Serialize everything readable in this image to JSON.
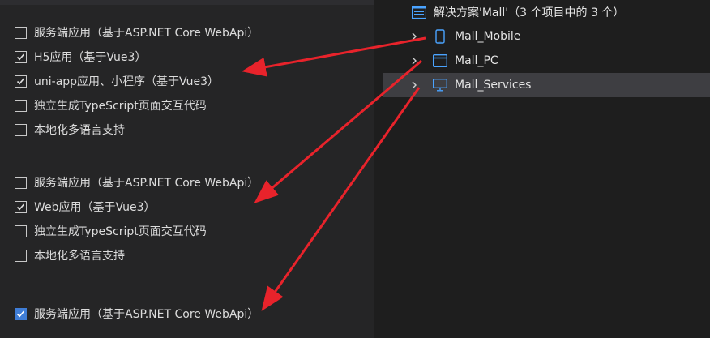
{
  "left": {
    "options": [
      {
        "label": "服务端应用（基于ASP.NET Core WebApi）",
        "checked": false
      },
      {
        "label": "H5应用（基于Vue3）",
        "checked": true
      },
      {
        "label": "uni-app应用、小程序（基于Vue3）",
        "checked": true
      },
      {
        "label": "独立生成TypeScript页面交互代码",
        "checked": false
      },
      {
        "label": "本地化多语言支持",
        "checked": false
      },
      {
        "label": "服务端应用（基于ASP.NET Core WebApi）",
        "checked": false
      },
      {
        "label": "Web应用（基于Vue3）",
        "checked": true
      },
      {
        "label": "独立生成TypeScript页面交互代码",
        "checked": false
      },
      {
        "label": "本地化多语言支持",
        "checked": false
      },
      {
        "label": "服务端应用（基于ASP.NET Core WebApi）",
        "checked": true
      }
    ]
  },
  "solution": {
    "title": "解决方案'Mall'（3 个项目中的 3 个）",
    "projects": [
      {
        "name": "Mall_Mobile",
        "icon": "mobile-icon"
      },
      {
        "name": "Mall_PC",
        "icon": "window-icon"
      },
      {
        "name": "Mall_Services",
        "icon": "monitor-icon"
      }
    ]
  },
  "colors": {
    "arrow": "#e8232b",
    "accent": "#3f7dd6",
    "icon_blue": "#4aa3ff"
  }
}
